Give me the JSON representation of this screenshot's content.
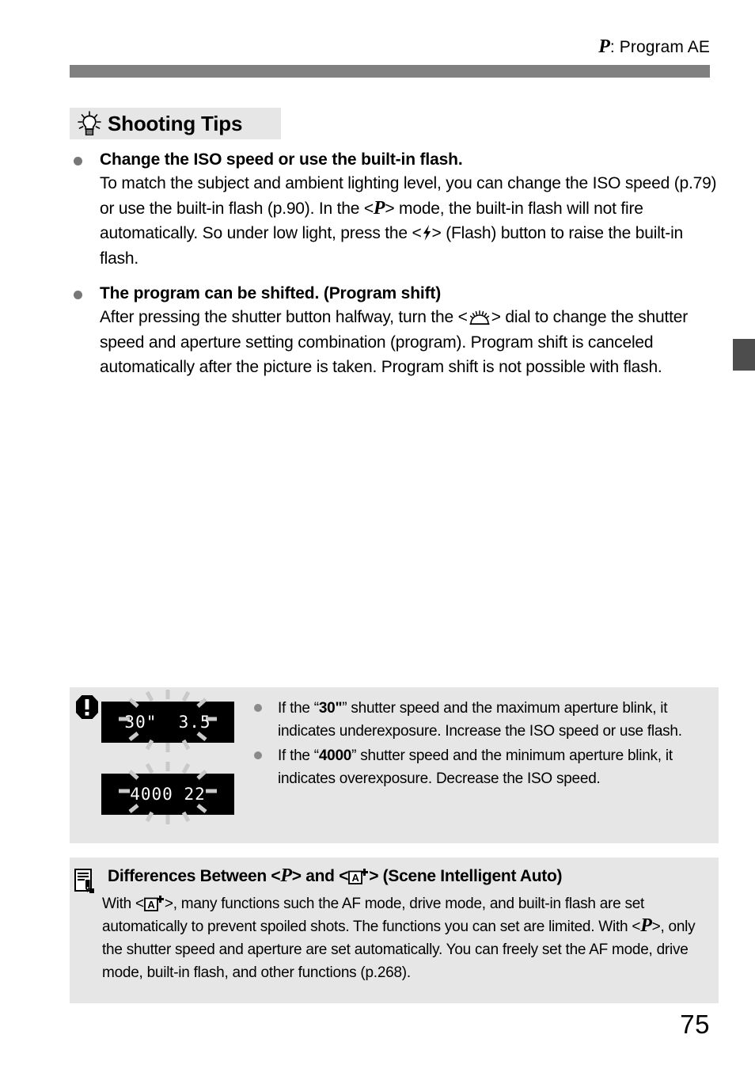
{
  "header": {
    "mode_glyph": "P",
    "title": ": Program AE",
    "rule_color": "#808080",
    "edge_tab_color": "#4d4d4d"
  },
  "tips_section": {
    "icon": "lightbulb-icon",
    "title": "Shooting Tips",
    "box_color": "#e6e6e6",
    "tips": [
      {
        "heading": "Change the ISO speed or use the built-in flash.",
        "body_part1": "To match the subject and ambient lighting level, you can change the ISO speed (p.79) or use the built-in flash (p.90). In the <",
        "body_part2": "> mode, the built-in flash will not fire automatically. So under low light, press the <",
        "body_part3": "> (Flash) button to raise the built-in flash.",
        "inline_glyph_1": "P",
        "inline_glyph_2": "flash-icon"
      },
      {
        "heading": "The program can be shifted. (Program shift)",
        "body_part1": "After pressing the shutter button halfway, turn the <",
        "body_part2": "> dial to change the shutter speed and aperture setting combination (program). Program shift is canceled automatically after the picture is taken. Program shift is not possible with flash.",
        "inline_glyph_1": "main-dial-icon"
      }
    ]
  },
  "caution_box": {
    "icon": "caution-exclamation-icon",
    "background": "#e6e6e6",
    "lcd_displays": [
      {
        "label": "underexposure-lcd",
        "text": "30\"  3.5"
      },
      {
        "label": "overexposure-lcd",
        "text": "4000 22"
      }
    ],
    "items": [
      {
        "prefix": "If the “",
        "bold": "30\"",
        "suffix": "” shutter speed and the maximum aperture blink, it indicates underexposure. Increase the ISO speed or use flash."
      },
      {
        "prefix": "If the “",
        "bold": "4000",
        "suffix": "” shutter speed and the minimum aperture blink, it indicates overexposure. Decrease the ISO speed."
      }
    ]
  },
  "info_box": {
    "icon": "note-pencil-icon",
    "background": "#e6e6e6",
    "heading_part1": "Differences Between <",
    "heading_glyph_1": "P",
    "heading_part2": "> and <",
    "heading_glyph_2": "scene-intelligent-auto-icon",
    "heading_part3": "> (Scene Intelligent Auto)",
    "body_part1": "With <",
    "body_glyph_1": "scene-intelligent-auto-icon",
    "body_part2": ">, many functions such the AF mode, drive mode, and built-in flash are set automatically to prevent spoiled shots. The functions you can set are limited. With <",
    "body_glyph_2": "P",
    "body_part3": ">, only the shutter speed and aperture are set automatically. You can freely set the AF mode, drive mode, built-in flash, and other functions (p.268)."
  },
  "footer": {
    "page_number": "75"
  }
}
